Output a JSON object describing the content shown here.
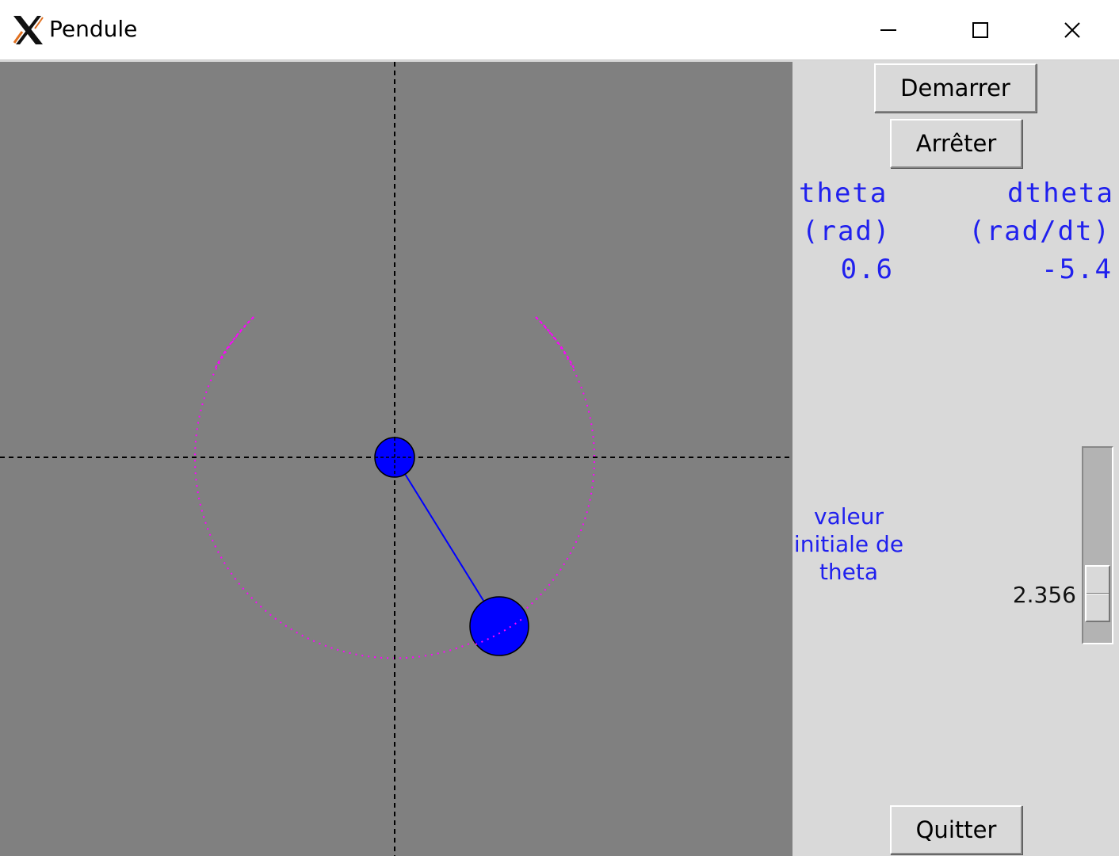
{
  "window": {
    "title": "Pendule",
    "app_icon": "x11-icon",
    "controls": [
      "minimize-icon",
      "maximize-icon",
      "close-icon"
    ]
  },
  "colors": {
    "canvas_bg": "#808080",
    "panel_bg": "#d9d9d9",
    "pendulum_fill": "#0000ff",
    "trace": "#ff00ff",
    "label_text": "#2020ee"
  },
  "controls": {
    "start_label": "Demarrer",
    "stop_label": "Arrêter",
    "quit_label": "Quitter"
  },
  "readout": {
    "theta_label": "theta",
    "theta_unit": "(rad)",
    "theta_value": "0.6",
    "dtheta_label": "dtheta",
    "dtheta_unit": "(rad/dt)",
    "dtheta_value": "-5.4"
  },
  "initial_theta": {
    "label": "valeur initiale de theta",
    "value": "2.356"
  }
}
